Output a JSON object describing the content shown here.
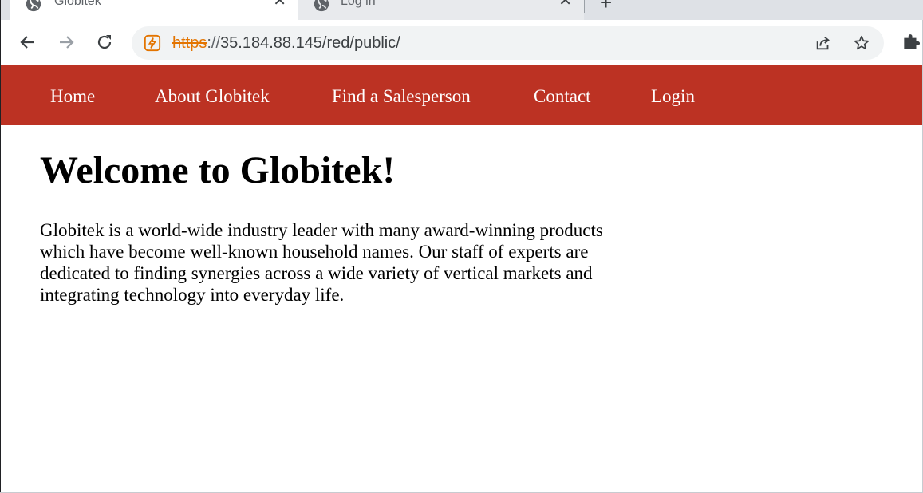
{
  "browser": {
    "tabs": [
      {
        "title": "Globitek",
        "active": true,
        "icon": "globe-icon"
      },
      {
        "title": "Log in",
        "active": false,
        "icon": "globe-icon"
      }
    ],
    "new_tab_icon": "plus-icon",
    "url": {
      "scheme": "https",
      "separator": "://",
      "rest": "35.184.88.145/red/public/"
    },
    "icons": {
      "back": "back-arrow-icon",
      "forward": "forward-arrow-icon",
      "reload": "reload-icon",
      "security": "not-secure-icon",
      "share": "share-icon",
      "bookmark": "star-icon",
      "extensions": "puzzle-icon"
    },
    "colors": {
      "tabstrip": "#dee1e6",
      "omnibox": "#f1f3f4",
      "insecure_scheme": "#e37400"
    }
  },
  "site": {
    "nav": [
      {
        "label": "Home"
      },
      {
        "label": "About Globitek"
      },
      {
        "label": "Find a Salesperson"
      },
      {
        "label": "Contact"
      },
      {
        "label": "Login"
      }
    ],
    "heading": "Welcome to Globitek!",
    "intro": "Globitek is a world-wide industry leader with many award-winning products which have become well-known household names. Our staff of experts are dedicated to finding synergies across a wide variety of vertical markets and integrating technology into everyday life.",
    "colors": {
      "nav_background": "#bc3223",
      "nav_text": "#ffffff"
    }
  }
}
